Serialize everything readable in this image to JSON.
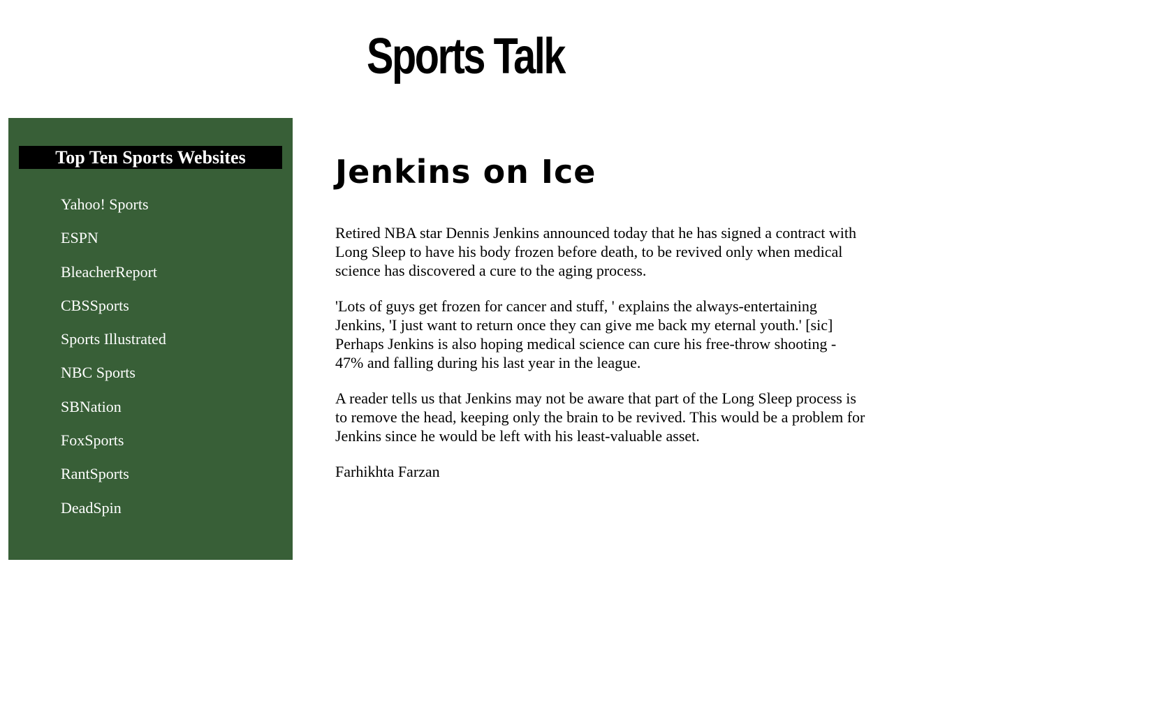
{
  "header": {
    "site_title": "Sports Talk"
  },
  "sidebar": {
    "heading": "Top Ten Sports Websites",
    "links": [
      {
        "label": "Yahoo! Sports"
      },
      {
        "label": "ESPN"
      },
      {
        "label": "BleacherReport"
      },
      {
        "label": "CBSSports"
      },
      {
        "label": "Sports Illustrated"
      },
      {
        "label": "NBC Sports"
      },
      {
        "label": "SBNation"
      },
      {
        "label": "FoxSports"
      },
      {
        "label": "RantSports"
      },
      {
        "label": "DeadSpin"
      }
    ]
  },
  "article": {
    "title": "Jenkins on Ice",
    "paragraphs": [
      "Retired NBA star Dennis Jenkins announced today that he has signed a contract with Long Sleep to have his body frozen before death, to be revived only when medical science has discovered a cure to the aging process.",
      "'Lots of guys get frozen for cancer and stuff, ' explains the always-entertaining Jenkins, 'I just want to return once they can give me back my eternal youth.' [sic] Perhaps Jenkins is also hoping medical science can cure his free-throw shooting - 47% and falling during his last year in the league.",
      "A reader tells us that Jenkins may not be aware that part of the Long Sleep process is to remove the head, keeping only the brain to be revived. This would be a problem for Jenkins since he would be left with his least-valuable asset."
    ],
    "author": "Farhikhta Farzan"
  },
  "colors": {
    "sidebar_background": "#385f37",
    "sidebar_heading_background": "#000000",
    "sidebar_text": "#ffffff",
    "page_background": "#ffffff"
  }
}
